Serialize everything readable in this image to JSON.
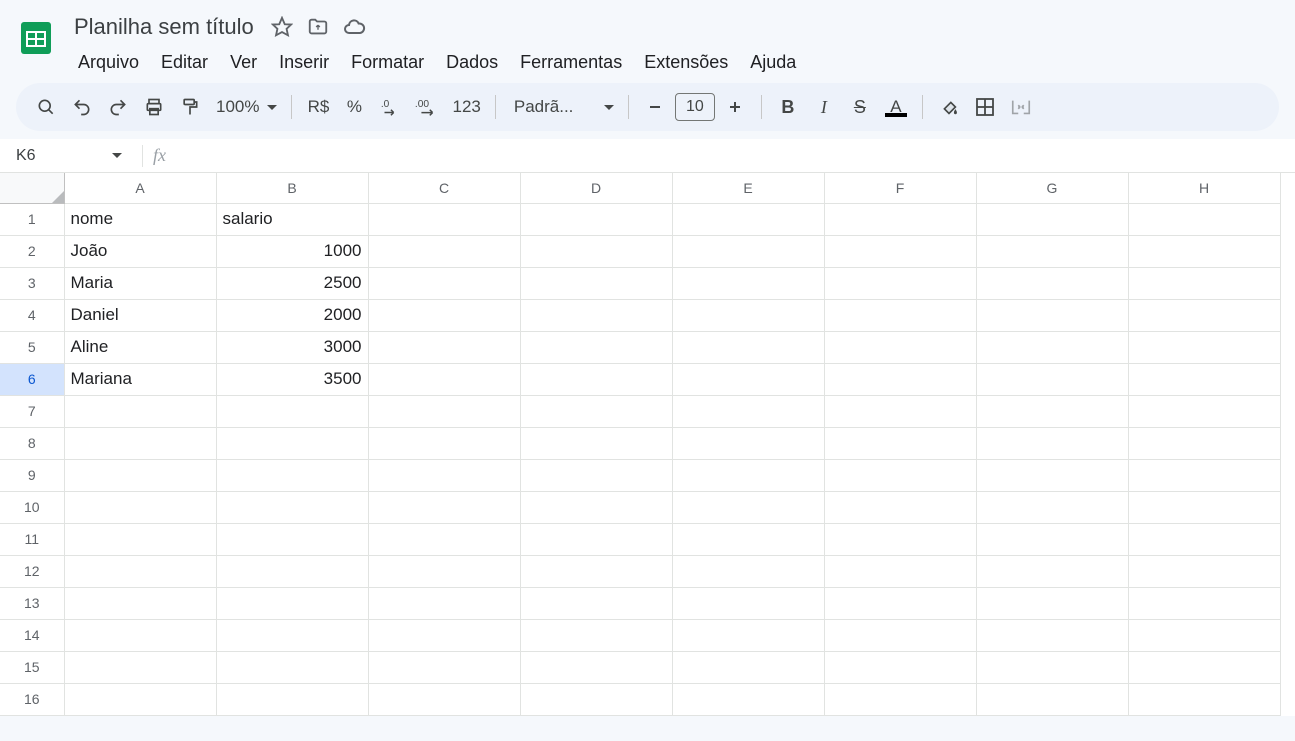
{
  "header": {
    "title": "Planilha sem título",
    "menus": [
      "Arquivo",
      "Editar",
      "Ver",
      "Inserir",
      "Formatar",
      "Dados",
      "Ferramentas",
      "Extensões",
      "Ajuda"
    ]
  },
  "toolbar": {
    "zoom": "100%",
    "currency": "R$",
    "percent": "%",
    "numfmt": "123",
    "font": "Padrã...",
    "fontsize": "10"
  },
  "formula_bar": {
    "name_box": "K6",
    "fx": ""
  },
  "grid": {
    "columns": [
      "A",
      "B",
      "C",
      "D",
      "E",
      "F",
      "G",
      "H"
    ],
    "rows": [
      1,
      2,
      3,
      4,
      5,
      6,
      7,
      8,
      9,
      10,
      11,
      12,
      13,
      14,
      15,
      16
    ],
    "selected_row": 6,
    "data": {
      "1": {
        "A": "nome",
        "B": "salario"
      },
      "2": {
        "A": "João",
        "B": "1000"
      },
      "3": {
        "A": "Maria",
        "B": "2500"
      },
      "4": {
        "A": "Daniel",
        "B": "2000"
      },
      "5": {
        "A": "Aline",
        "B": "3000"
      },
      "6": {
        "A": "Mariana",
        "B": "3500"
      }
    },
    "numeric_cols": [
      "B"
    ]
  },
  "chart_data": {
    "type": "table",
    "columns": [
      "nome",
      "salario"
    ],
    "rows": [
      {
        "nome": "João",
        "salario": 1000
      },
      {
        "nome": "Maria",
        "salario": 2500
      },
      {
        "nome": "Daniel",
        "salario": 2000
      },
      {
        "nome": "Aline",
        "salario": 3000
      },
      {
        "nome": "Mariana",
        "salario": 3500
      }
    ]
  }
}
